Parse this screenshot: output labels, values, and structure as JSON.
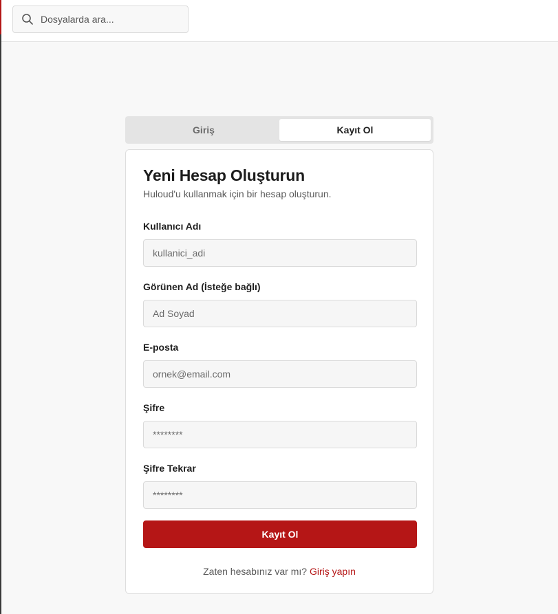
{
  "search": {
    "placeholder": "Dosyalarda ara..."
  },
  "tabs": [
    {
      "label": "Giriş",
      "active": false
    },
    {
      "label": "Kayıt Ol",
      "active": true
    }
  ],
  "form": {
    "title": "Yeni Hesap Oluşturun",
    "subtitle": "Huloud'u kullanmak için bir hesap oluşturun.",
    "fields": [
      {
        "label": "Kullanıcı Adı",
        "placeholder": "kullanici_adi",
        "type": "text"
      },
      {
        "label": "Görünen Ad (İsteğe bağlı)",
        "placeholder": "Ad Soyad",
        "type": "text"
      },
      {
        "label": "E-posta",
        "placeholder": "ornek@email.com",
        "type": "email"
      },
      {
        "label": "Şifre",
        "placeholder": "********",
        "type": "password"
      },
      {
        "label": "Şifre Tekrar",
        "placeholder": "********",
        "type": "password"
      }
    ],
    "submit_label": "Kayıt Ol",
    "footer_text": "Zaten hesabınız var mı?",
    "footer_link": "Giriş yapın"
  },
  "colors": {
    "accent": "#b51616",
    "background": "#f8f8f8",
    "card": "#ffffff"
  },
  "icons": {
    "search": "search-icon"
  }
}
